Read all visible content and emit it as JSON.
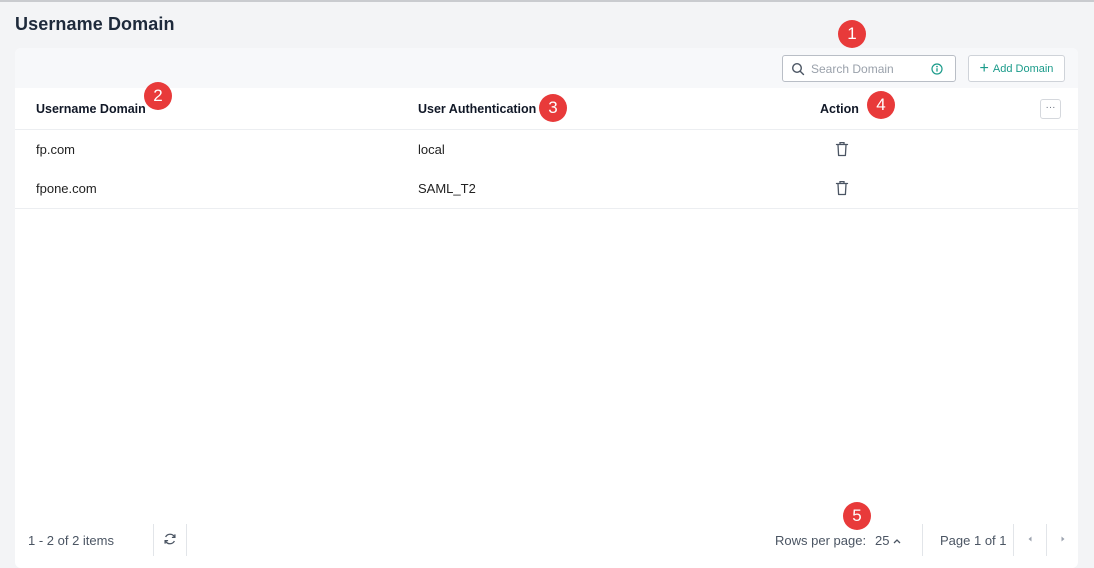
{
  "page": {
    "title": "Username Domain"
  },
  "toolbar": {
    "search_placeholder": "Search Domain",
    "add_button_label": "Add Domain"
  },
  "table": {
    "columns": [
      "Username Domain",
      "User Authentication",
      "Action"
    ],
    "more_label": "···",
    "rows": [
      {
        "domain": "fp.com",
        "auth": "local"
      },
      {
        "domain": "fpone.com",
        "auth": "SAML_T2"
      }
    ]
  },
  "footer": {
    "count_text": "1 - 2 of 2 items",
    "rows_per_page_label": "Rows per page:",
    "rows_per_page_value": "25",
    "page_info": "Page 1 of 1"
  },
  "annotations": [
    "1",
    "2",
    "3",
    "4",
    "5"
  ],
  "colors": {
    "accent": "#1a9b8a",
    "badge": "#e83a3a"
  },
  "icons": [
    "search-icon",
    "info-icon",
    "plus-icon",
    "more-icon",
    "trash-icon",
    "refresh-icon",
    "chevron-up-icon",
    "prev-page-icon",
    "next-page-icon"
  ]
}
